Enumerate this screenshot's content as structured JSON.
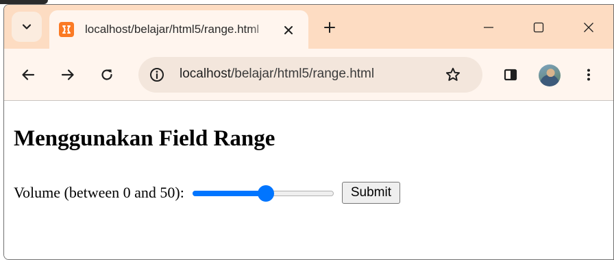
{
  "browser": {
    "tab": {
      "title": "localhost/belajar/html5/range.html"
    },
    "address_bar": {
      "url_host": "localhost",
      "url_path": "/belajar/html5/range.html"
    },
    "colors": {
      "tabstrip": "#fddcc2",
      "toolbar": "#fff5ee",
      "favicon": "#fb7a24"
    }
  },
  "page": {
    "heading": "Menggunakan Field Range",
    "form": {
      "label": "Volume (between 0 and 50):",
      "range": {
        "min": 0,
        "max": 50,
        "value": 26
      },
      "submit_label": "Submit"
    },
    "accent_color": "#0075ff"
  }
}
